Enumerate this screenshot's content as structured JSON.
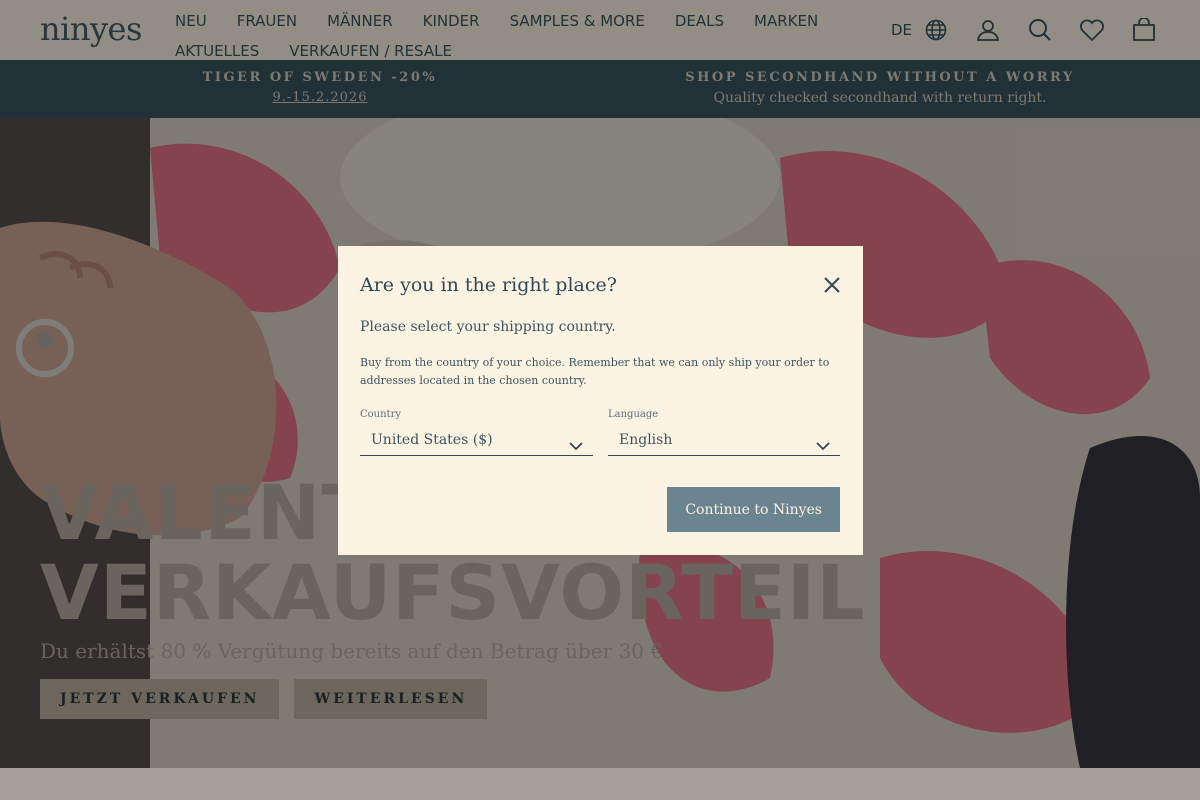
{
  "header": {
    "logo": "ninyes",
    "nav": [
      {
        "label": "NEU"
      },
      {
        "label": "FRAUEN"
      },
      {
        "label": "MÄNNER"
      },
      {
        "label": "KINDER"
      },
      {
        "label": "SAMPLES & MORE"
      },
      {
        "label": "DEALS"
      },
      {
        "label": "MARKEN"
      },
      {
        "label": "AKTUELLES"
      },
      {
        "label": "VERKAUFEN / RESALE"
      }
    ],
    "language": "DE",
    "icons": [
      "globe-icon",
      "account-icon",
      "search-icon",
      "wishlist-icon",
      "cart-icon"
    ]
  },
  "announcements": [
    {
      "title": "TIGER OF SWEDEN -20%",
      "sub": "9.-15.2.2026"
    },
    {
      "title": "SHOP SECONDHAND WITHOUT A WORRY",
      "sub": "Quality checked secondhand with return right."
    }
  ],
  "hero": {
    "title_line1": "VALENTI",
    "title_line2": "VERKAUFSVORTEIL",
    "subtitle": "Du erhältst 80 % Vergütung bereits auf den Betrag über 30 €",
    "buttons": [
      {
        "label": "JETZT VERKAUFEN"
      },
      {
        "label": "WEITERLESEN"
      }
    ]
  },
  "modal": {
    "title": "Are you in the right place?",
    "lead": "Please select your shipping country.",
    "desc": "Buy from the country of your choice. Remember that we can only ship your order to addresses located in the chosen country.",
    "country_label": "Country",
    "country_value": "United States ($)",
    "language_label": "Language",
    "language_value": "English",
    "continue_label": "Continue to Ninyes"
  },
  "colors": {
    "primary": "#2d4a56",
    "modal_bg": "#fdf3e3",
    "button": "#6b8590",
    "pink": "#e8647a"
  }
}
